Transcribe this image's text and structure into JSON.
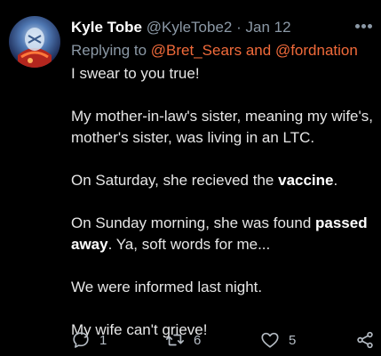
{
  "tweet": {
    "author_name": "Kyle Tobe",
    "author_handle": "@KyleTobe2",
    "separator": "·",
    "date": "Jan 12",
    "replying_prefix": "Replying to",
    "reply_mention_1": "@Bret_Sears",
    "reply_and": "and",
    "reply_mention_2": "@fordnation",
    "lines": {
      "l1": "I swear to you true!",
      "l2": "My mother-in-law's sister, meaning my wife's, mother's sister, was living in an LTC.",
      "l3_a": "On Saturday, she recieved the",
      "l3_b": "vaccine",
      "l3_c": ".",
      "l4_a": "On Sunday morning, she was found",
      "l4_b": "passed away",
      "l4_c": ". Ya, soft words for me...",
      "l5": "We were informed last night.",
      "l6": "My wife can't grieve!"
    }
  },
  "actions": {
    "reply_count": "1",
    "retweet_count": "6",
    "like_count": "5"
  },
  "icons": {
    "reply": "reply-icon",
    "retweet": "retweet-icon",
    "like": "heart-icon",
    "share": "share-icon",
    "more": "more-icon"
  },
  "colors": {
    "background": "#000000",
    "mention": "#f06a3a",
    "muted": "#8b98a5"
  }
}
